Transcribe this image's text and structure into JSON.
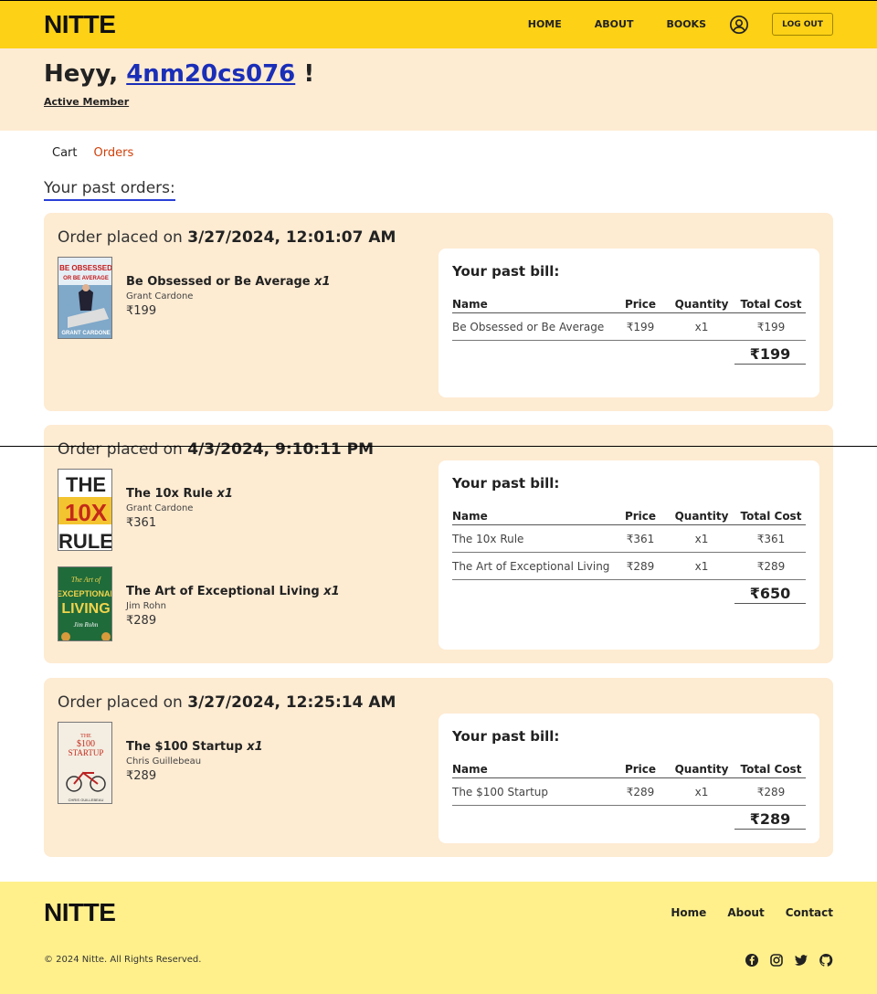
{
  "nav": {
    "brand": "NITTE",
    "links": [
      "HOME",
      "ABOUT",
      "BOOKS"
    ],
    "logout_label": "LOG OUT"
  },
  "greeting": {
    "prefix": "Heyy,",
    "username": "4nm20cs076",
    "suffix": "!",
    "status": "Active Member"
  },
  "tabs": [
    "Cart",
    "Orders"
  ],
  "active_tab": "Orders",
  "section_title": "Your past orders:",
  "orders": [
    {
      "placed_prefix": "Order placed on",
      "placed_at": "3/27/2024, 12:01:07 AM",
      "items": [
        {
          "title": "Be Obsessed or Be Average",
          "qty": "x1",
          "author": "Grant Cardone",
          "price": "₹199"
        }
      ],
      "bill": {
        "title": "Your past bill:",
        "headers": [
          "Name",
          "Price",
          "Quantity",
          "Total Cost"
        ],
        "rows": [
          [
            "Be Obsessed or Be Average",
            "₹199",
            "x1",
            "₹199"
          ]
        ],
        "total": "₹199"
      }
    },
    {
      "placed_prefix": "Order placed on",
      "placed_at": "4/3/2024, 9:10:11 PM",
      "items": [
        {
          "title": "The 10x Rule",
          "qty": "x1",
          "author": "Grant Cardone",
          "price": "₹361"
        },
        {
          "title": "The Art of Exceptional Living",
          "qty": "x1",
          "author": "Jim Rohn",
          "price": "₹289"
        }
      ],
      "bill": {
        "title": "Your past bill:",
        "headers": [
          "Name",
          "Price",
          "Quantity",
          "Total Cost"
        ],
        "rows": [
          [
            "The 10x Rule",
            "₹361",
            "x1",
            "₹361"
          ],
          [
            "The Art of Exceptional Living",
            "₹289",
            "x1",
            "₹289"
          ]
        ],
        "total": "₹650"
      }
    },
    {
      "placed_prefix": "Order placed on",
      "placed_at": "3/27/2024, 12:25:14 AM",
      "items": [
        {
          "title": "The $100 Startup",
          "qty": "x1",
          "author": "Chris Guillebeau",
          "price": "₹289"
        }
      ],
      "bill": {
        "title": "Your past bill:",
        "headers": [
          "Name",
          "Price",
          "Quantity",
          "Total Cost"
        ],
        "rows": [
          [
            "The $100 Startup",
            "₹289",
            "x1",
            "₹289"
          ]
        ],
        "total": "₹289"
      }
    }
  ],
  "covers": {
    "be_obsessed": {
      "line1": "BE OBSESSED",
      "line2": "OR BE AVERAGE",
      "author": "GRANT CARDONE"
    },
    "ten_x": {
      "line1": "THE",
      "line2": "10X",
      "line3": "RULE"
    },
    "art_living": {
      "line1": "The Art of",
      "line2": "EXCEPTIONAL",
      "line3": "LIVING",
      "author": "Jim Rohn"
    },
    "startup": {
      "line1": "THE",
      "line2": "$100",
      "line3": "STARTUP",
      "author": "CHRIS GUILLEBEAU"
    }
  },
  "footer": {
    "brand": "NITTE",
    "links": [
      "Home",
      "About",
      "Contact"
    ],
    "copyright": "© 2024 Nitte. All Rights Reserved.",
    "socials": [
      "facebook-icon",
      "instagram-icon",
      "twitter-icon",
      "github-icon"
    ]
  },
  "colors": {
    "header_bg": "#fcd116",
    "band_bg": "#fdebd2",
    "footer_bg": "#fff08c",
    "link_blue": "#1a2eb8",
    "active_tab": "#d0400a"
  }
}
